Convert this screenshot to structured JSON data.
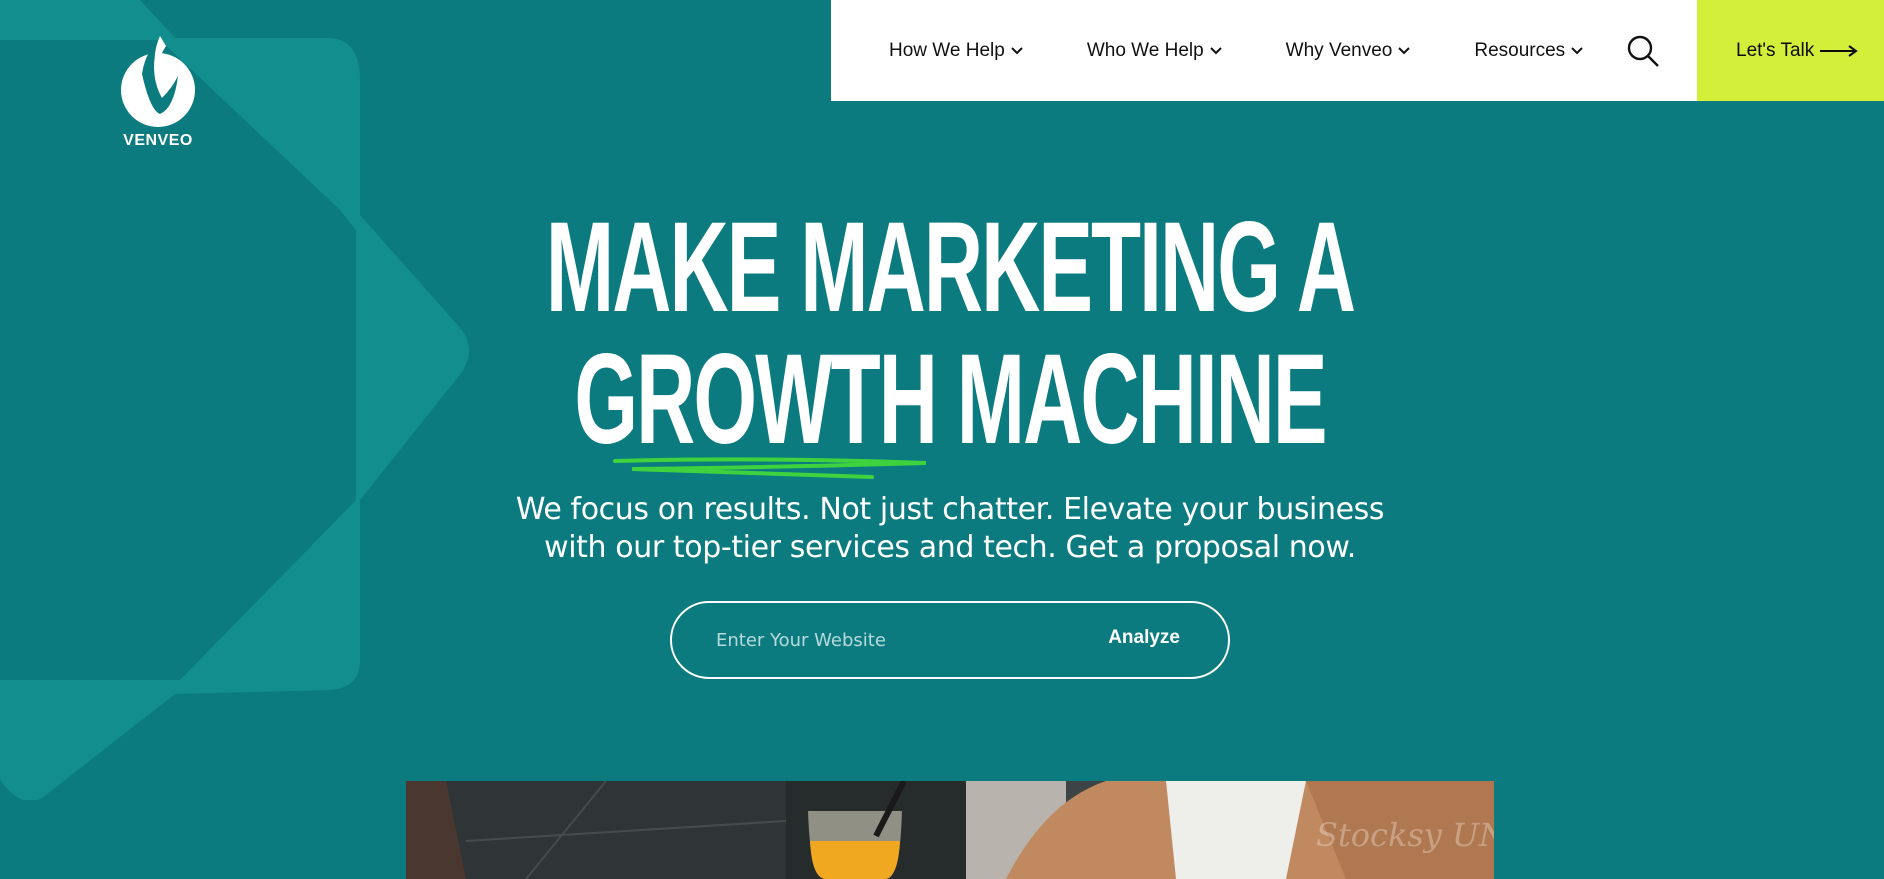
{
  "brand": {
    "name": "VENVEO",
    "accent_color": "#d4ef3a",
    "background_color": "#0b7b80"
  },
  "nav": {
    "items": [
      {
        "label": "How We Help",
        "icon": "chevron-down-icon"
      },
      {
        "label": "Who We Help",
        "icon": "chevron-down-icon"
      },
      {
        "label": "Why Venveo",
        "icon": "chevron-down-icon"
      },
      {
        "label": "Resources",
        "icon": "chevron-down-icon"
      }
    ],
    "search_icon": "search-icon",
    "cta_label": "Let's Talk",
    "cta_icon": "arrow-right-icon"
  },
  "hero": {
    "headline_line1": "MAKE MARKETING A",
    "headline_line2": "GROWTH MACHINE",
    "subtext": "We focus on results. Not just chatter. Elevate your business with our top-tier services and tech. Get a proposal now.",
    "input_placeholder": "Enter Your Website",
    "input_value": "",
    "analyze_label": "Analyze"
  },
  "photo": {
    "watermark": "Stocksy UNITED"
  }
}
